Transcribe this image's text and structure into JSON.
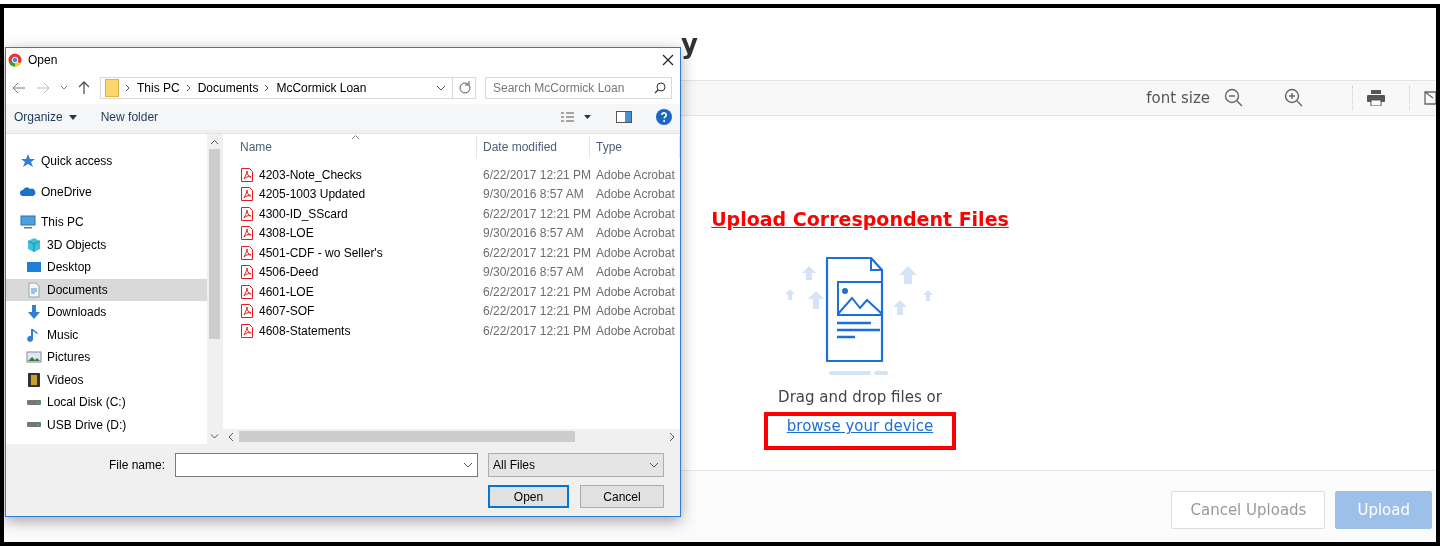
{
  "page": {
    "title_fragment": "y",
    "toolbar": {
      "font_size_label": "font size"
    },
    "upload": {
      "heading": "Upload Correspondent Files",
      "prompt": "Drag and drop files or",
      "link": "browse your device"
    },
    "footer_buttons": [
      {
        "label": "Cancel Uploads",
        "kind": "secondary",
        "disabled": true
      },
      {
        "label": "Upload",
        "kind": "primary",
        "disabled": true
      }
    ]
  },
  "dialog": {
    "title": "Open",
    "address": [
      "This PC",
      "Documents",
      "McCormick Loan"
    ],
    "search": {
      "placeholder": "Search McCormick Loan"
    },
    "commands": {
      "organize": "Organize",
      "new_folder": "New folder"
    },
    "nav": [
      {
        "label": "Quick access",
        "kind": "star",
        "selected": false
      },
      {
        "label": "OneDrive",
        "kind": "cloud",
        "selected": false
      },
      {
        "label": "This PC",
        "kind": "computer",
        "selected": false,
        "children": [
          {
            "label": "3D Objects",
            "kind": "cube",
            "selected": false
          },
          {
            "label": "Desktop",
            "kind": "desktop",
            "selected": false
          },
          {
            "label": "Documents",
            "kind": "document",
            "selected": true
          },
          {
            "label": "Downloads",
            "kind": "download",
            "selected": false
          },
          {
            "label": "Music",
            "kind": "music",
            "selected": false
          },
          {
            "label": "Pictures",
            "kind": "picture",
            "selected": false
          },
          {
            "label": "Videos",
            "kind": "video",
            "selected": false
          },
          {
            "label": "Local Disk (C:)",
            "kind": "disk",
            "selected": false
          },
          {
            "label": "USB Drive (D:)",
            "kind": "disk",
            "selected": false
          }
        ]
      }
    ],
    "columns": [
      "Name",
      "Date modified",
      "Type"
    ],
    "files": [
      {
        "name": "4203-Note_Checks",
        "date": "6/22/2017 12:21 PM",
        "type": "Adobe Acrobat"
      },
      {
        "name": "4205-1003 Updated",
        "date": "9/30/2016 8:57 AM",
        "type": "Adobe Acrobat"
      },
      {
        "name": "4300-ID_SScard",
        "date": "6/22/2017 12:21 PM",
        "type": "Adobe Acrobat"
      },
      {
        "name": "4308-LOE",
        "date": "9/30/2016 8:57 AM",
        "type": "Adobe Acrobat"
      },
      {
        "name": "4501-CDF - wo Seller's",
        "date": "6/22/2017 12:21 PM",
        "type": "Adobe Acrobat"
      },
      {
        "name": "4506-Deed",
        "date": "9/30/2016 8:57 AM",
        "type": "Adobe Acrobat"
      },
      {
        "name": "4601-LOE",
        "date": "6/22/2017 12:21 PM",
        "type": "Adobe Acrobat"
      },
      {
        "name": "4607-SOF",
        "date": "6/22/2017 12:21 PM",
        "type": "Adobe Acrobat"
      },
      {
        "name": "4608-Statements",
        "date": "6/22/2017 12:21 PM",
        "type": "Adobe Acrobat"
      }
    ],
    "file_name_label": "File name:",
    "filter": "All Files",
    "buttons": [
      {
        "label": "Open",
        "default": true
      },
      {
        "label": "Cancel",
        "default": false
      }
    ]
  }
}
